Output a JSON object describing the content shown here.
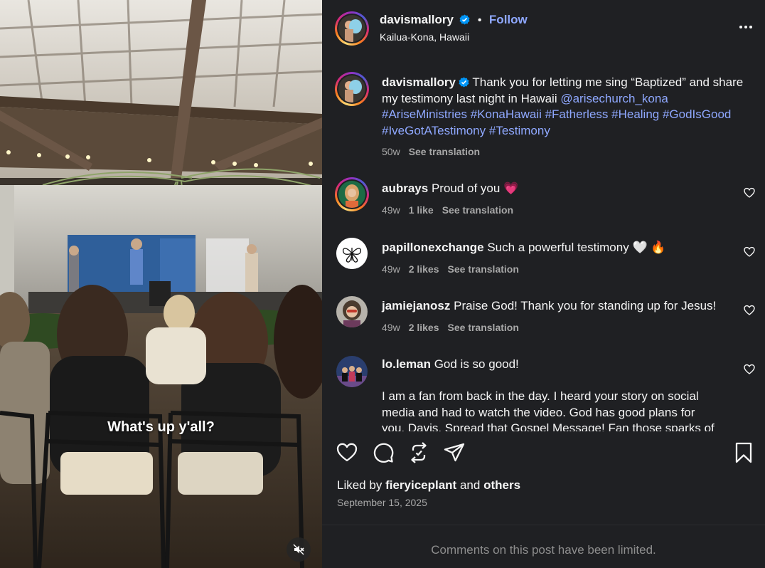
{
  "video": {
    "caption": "What's up y'all?",
    "mute_icon": "speaker-muted-icon"
  },
  "post": {
    "author": "davismallory",
    "follow_label": "Follow",
    "location": "Kailua-Kona, Hawaii",
    "dot": "•",
    "caption_text": "Thank you for letting me sing “Baptized” and share my testimony last night in Hawaii",
    "mention": "@arisechurch_kona",
    "hashtags_line1": "#AriseMinistries #KonaHawaii #Fatherless #Healing #GodIsGood",
    "hashtags_line2": "#IveGotATestimony #Testimony",
    "age": "50w",
    "see_translation": "See translation"
  },
  "comments": [
    {
      "user": "aubrays",
      "text": "Proud of you",
      "emoji": "💗",
      "age": "49w",
      "likes": "1 like",
      "translate": "See translation"
    },
    {
      "user": "papillonexchange",
      "text": "Such a powerful testimony",
      "emoji": "🤍 🔥",
      "age": "49w",
      "likes": "2 likes",
      "translate": "See translation"
    },
    {
      "user": "jamiejanosz",
      "text": "Praise God! Thank you for standing up for Jesus!",
      "age": "49w",
      "likes": "2 likes",
      "translate": "See translation"
    },
    {
      "user": "lo.leman",
      "text": "God is so good!",
      "body_line1": "I am a fan from back in the day. I heard your story on social",
      "body_line2": "media and had to watch the video. God has good plans for",
      "body_line3": "you, Davis. Spread that Gospel Message! Fan those sparks of"
    }
  ],
  "footer": {
    "liked_by_prefix": "Liked by",
    "liked_by_user": "fieryiceplant",
    "liked_by_and": "and",
    "liked_by_others": "others",
    "date": "September 15, 2025",
    "limited_notice": "Comments on this post have been limited."
  },
  "colors": {
    "panel_bg": "#1f2023",
    "link": "#8fa8ff",
    "verified": "#0095f6",
    "muted_text": "#a8a8a8"
  }
}
